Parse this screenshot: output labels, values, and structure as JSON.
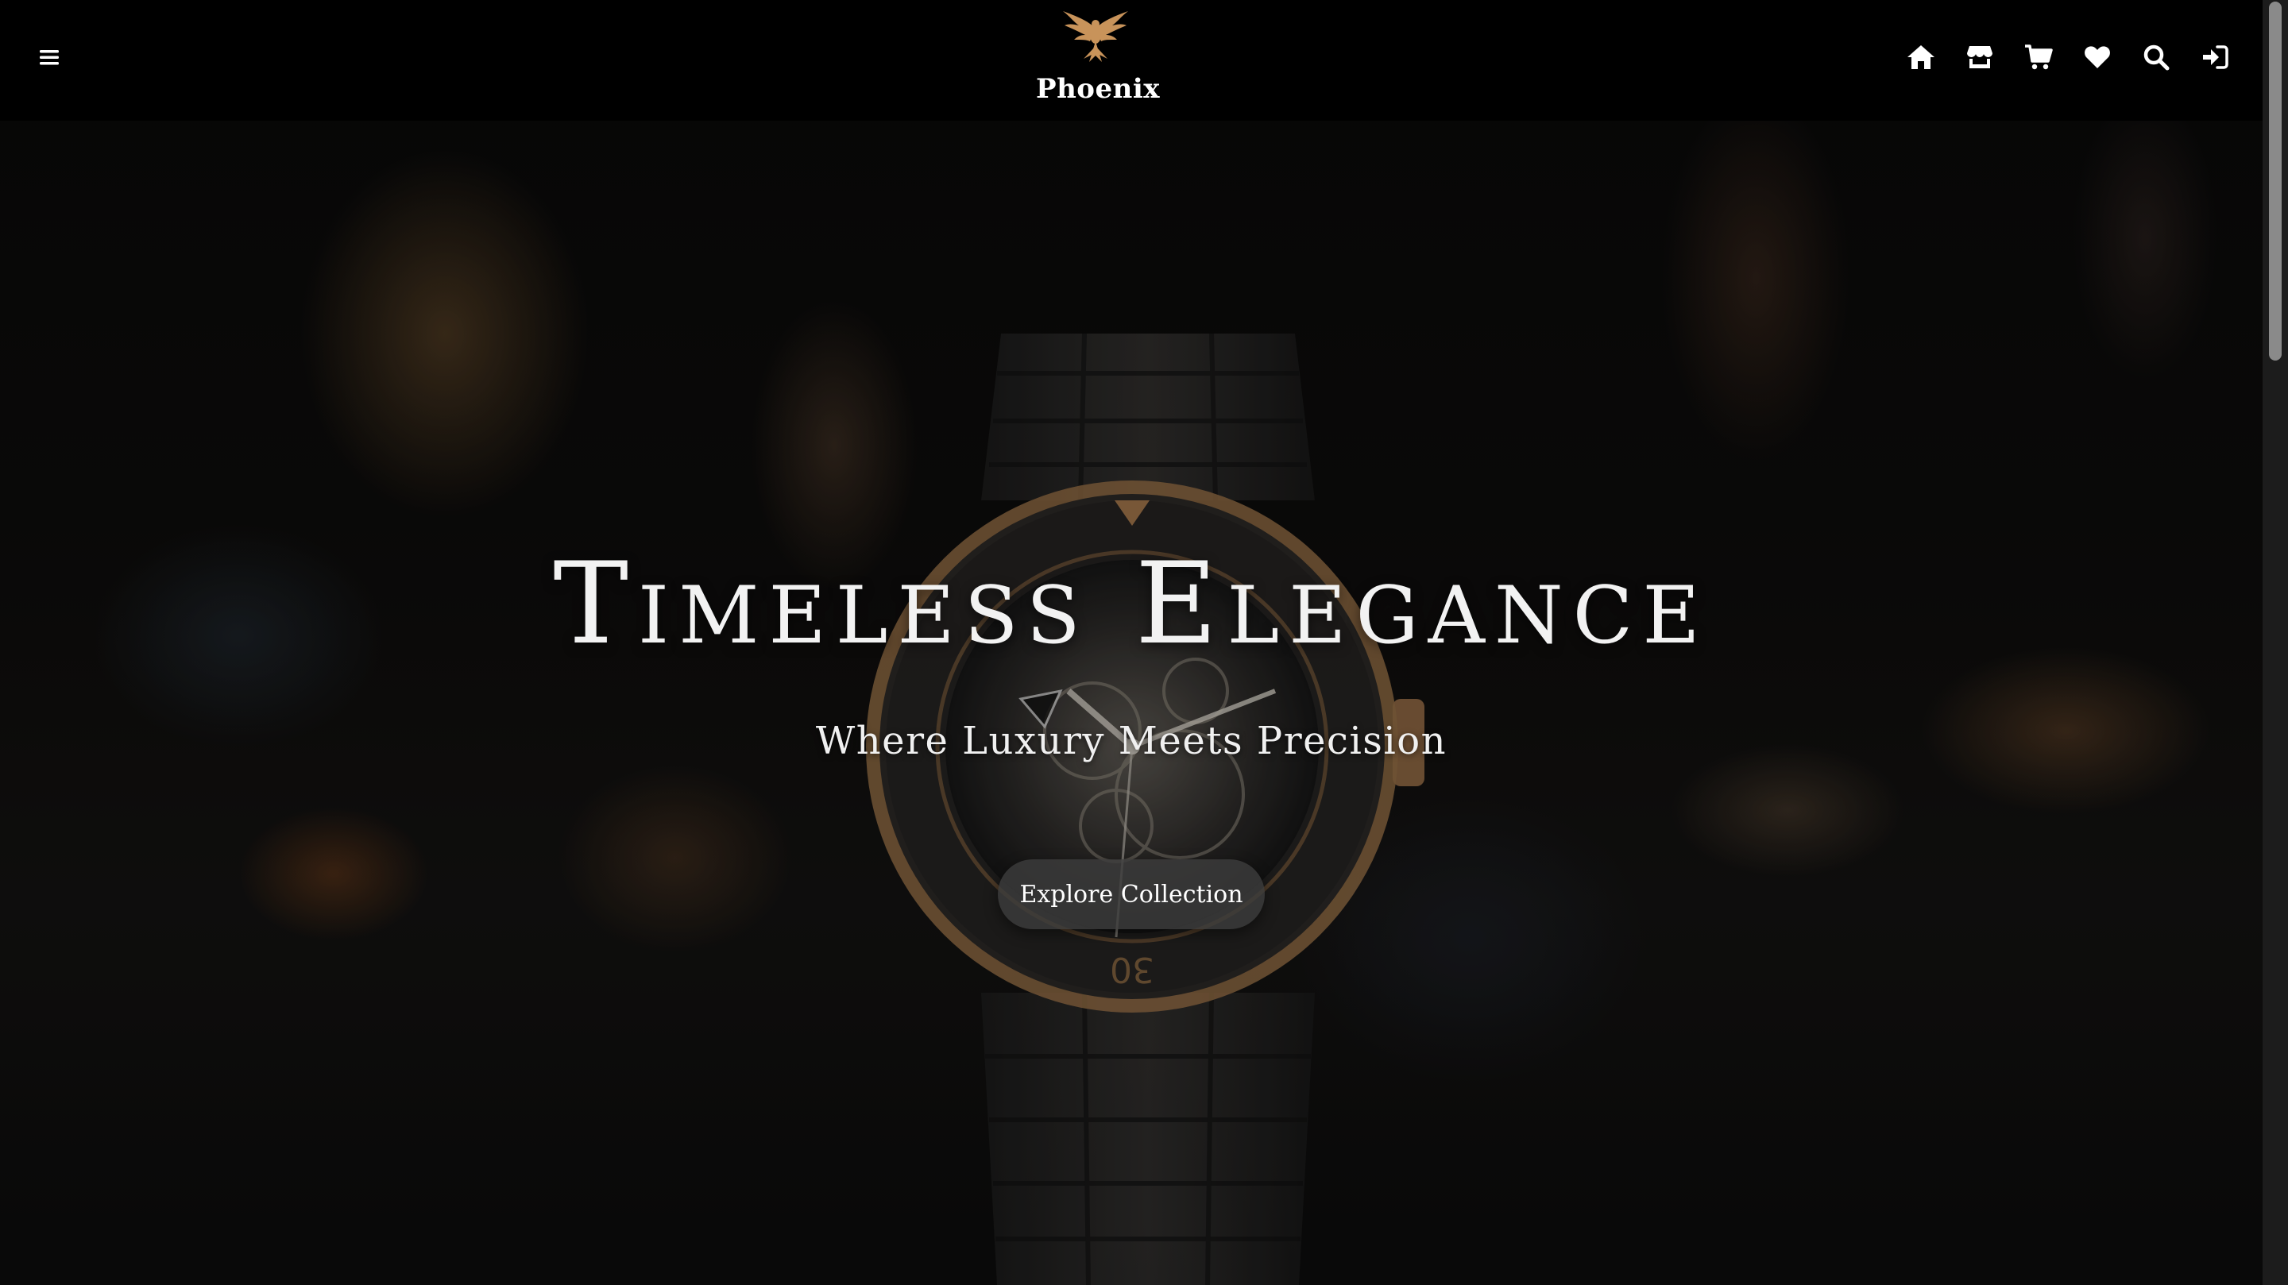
{
  "header": {
    "brand_name": "Phoenix",
    "logo_icon": "phoenix-bird-logo",
    "menu_icon": "hamburger-menu-icon",
    "nav_icons": [
      "home-icon",
      "store-icon",
      "cart-icon",
      "heart-icon",
      "search-icon",
      "sign-in-icon"
    ]
  },
  "hero": {
    "title": "Timeless Elegance",
    "subtitle": "Where Luxury Meets Precision",
    "cta_label": "Explore Collection",
    "bezel_marker": "30",
    "background_image": "blurred luxury watch with rose-gold bezel"
  },
  "colors": {
    "header_bg": "#000000",
    "accent_gold": "#c8935a",
    "text_primary": "#ffffff",
    "button_bg": "#3c3c3c"
  }
}
